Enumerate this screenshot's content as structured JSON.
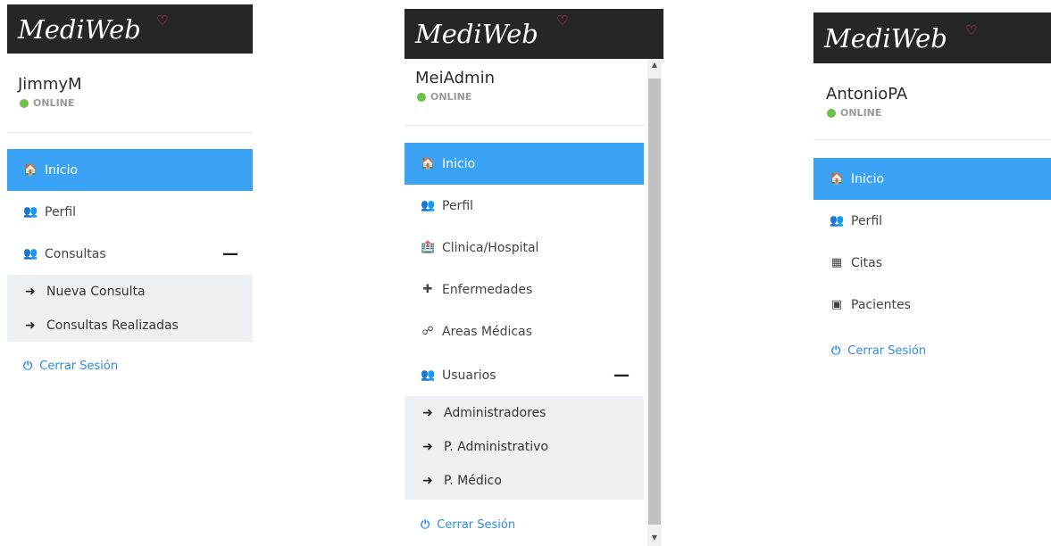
{
  "brand": {
    "logo_text": "MediWeb",
    "heart_glyph": "♡"
  },
  "status_online": "ONLINE",
  "panels": [
    {
      "user": "JimmyM",
      "nav": [
        {
          "label": "Inicio",
          "icon": "home-icon",
          "active": true
        },
        {
          "label": "Perfil",
          "icon": "user-md-icon"
        },
        {
          "label": "Consultas",
          "icon": "users-icon",
          "expanded": true
        }
      ],
      "submenu": [
        "Nueva Consulta",
        "Consultas Realizadas"
      ],
      "logout": "Cerrar Sesión"
    },
    {
      "user": "MeiAdmin",
      "nav": [
        {
          "label": "Inicio",
          "icon": "home-icon",
          "active": true
        },
        {
          "label": "Perfil",
          "icon": "user-md-icon"
        },
        {
          "label": "Clinica/Hospital",
          "icon": "hospital-icon"
        },
        {
          "label": "Enfermedades",
          "icon": "medkit-icon"
        },
        {
          "label": "Areas Médicas",
          "icon": "sitemap-icon"
        },
        {
          "label": "Usuarios",
          "icon": "users-icon",
          "expanded": true
        }
      ],
      "submenu": [
        "Administradores",
        "P. Administrativo",
        "P. Médico"
      ],
      "logout": "Cerrar Sesión"
    },
    {
      "user": "AntonioPA",
      "nav": [
        {
          "label": "Inicio",
          "icon": "home-icon",
          "active": true
        },
        {
          "label": "Perfil",
          "icon": "user-md-icon"
        },
        {
          "label": "Citas",
          "icon": "calendar-icon"
        },
        {
          "label": "Pacientes",
          "icon": "address-book-icon"
        }
      ],
      "logout": "Cerrar Sesión"
    }
  ],
  "colors": {
    "active": "#3aa3f5",
    "logo_bg": "#262626",
    "online": "#6cc24a",
    "logout": "#2f8de4",
    "submenu_bg": "#eef1f4"
  }
}
